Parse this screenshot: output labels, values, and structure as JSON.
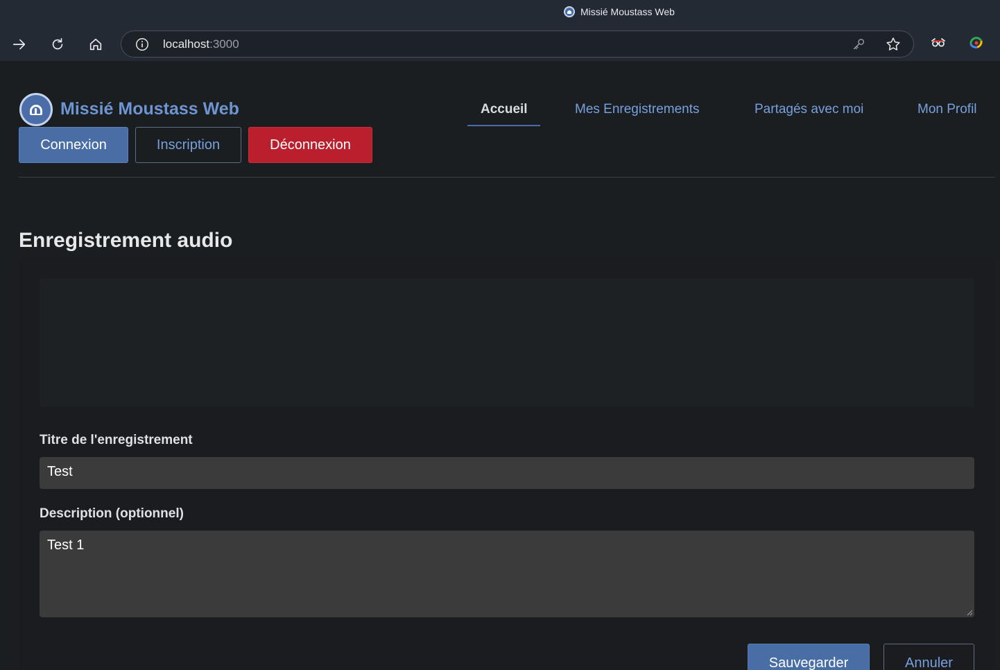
{
  "browser": {
    "tab_title": "Missié Moustass Web",
    "address_host": "localhost",
    "address_port": ":3000"
  },
  "header": {
    "brand": "Missié Moustass Web",
    "nav": [
      {
        "label": "Accueil",
        "active": true
      },
      {
        "label": "Mes Enregistrements",
        "active": false
      },
      {
        "label": "Partagés avec moi",
        "active": false
      },
      {
        "label": "Mon Profil",
        "active": false
      }
    ],
    "auth_buttons": {
      "login": "Connexion",
      "signup": "Inscription",
      "logout": "Déconnexion"
    }
  },
  "main": {
    "section_title": "Enregistrement audio",
    "form": {
      "title_label": "Titre de l'enregistrement",
      "title_value": "Test",
      "description_label": "Description (optionnel)",
      "description_value": "Test 1",
      "save_label": "Sauvegarder",
      "cancel_label": "Annuler"
    }
  },
  "colors": {
    "primary": "#496ea6",
    "danger": "#ba1f2d",
    "link": "#77a0dc",
    "background": "#1b1e21"
  }
}
